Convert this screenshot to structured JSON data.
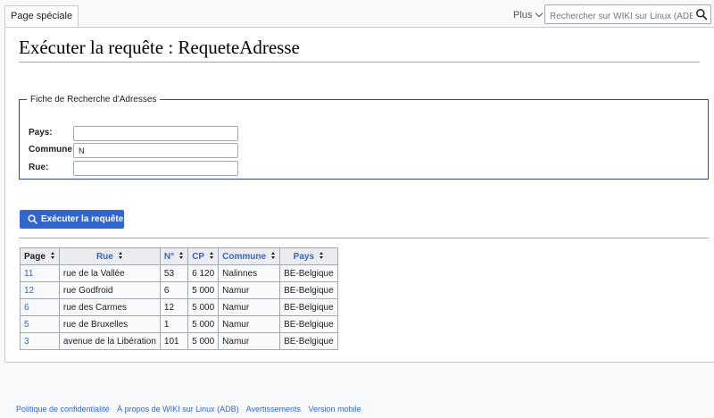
{
  "header": {
    "tab_label": "Page spéciale",
    "more_label": "Plus",
    "search_placeholder": "Rechercher sur WIKI sur Linux (ADB)"
  },
  "page": {
    "title": "Exécuter la requête : RequeteAdresse"
  },
  "form": {
    "legend": "Fiche de Recherche d'Adresses",
    "fields": [
      {
        "label": "Pays:",
        "value": ""
      },
      {
        "label": "Commune:",
        "value": "N"
      },
      {
        "label": "Rue:",
        "value": ""
      }
    ],
    "submit_label": "Exécuter la requête"
  },
  "table": {
    "headers": [
      "Page",
      "Rue",
      "N°",
      "CP",
      "Commune",
      "Pays"
    ],
    "rows": [
      {
        "page": "11",
        "rue": "rue de la Vallée",
        "num": "53",
        "cp": "6 120",
        "commune": "Nalinnes",
        "pays": "BE-Belgique"
      },
      {
        "page": "12",
        "rue": "rue Godfroid",
        "num": "6",
        "cp": "5 000",
        "commune": "Namur",
        "pays": "BE-Belgique"
      },
      {
        "page": "6",
        "rue": "rue des Carmes",
        "num": "12",
        "cp": "5 000",
        "commune": "Namur",
        "pays": "BE-Belgique"
      },
      {
        "page": "5",
        "rue": "rue de Bruxelles",
        "num": "1",
        "cp": "5 000",
        "commune": "Namur",
        "pays": "BE-Belgique"
      },
      {
        "page": "3",
        "rue": "avenue de la Libération",
        "num": "101",
        "cp": "5 000",
        "commune": "Namur",
        "pays": "BE-Belgique"
      }
    ]
  },
  "footer": {
    "links": [
      "Politique de confidentialité",
      "À propos de WIKI sur Linux (ADB)",
      "Avertissements",
      "Version mobile"
    ]
  },
  "colors": {
    "accent": "#3366cc",
    "form_border": "#2a4b8d",
    "header_bg": "#eaecf0"
  },
  "icons": {
    "search": "search-icon",
    "more": "chevron-down-icon",
    "sort": "sort-icon"
  }
}
